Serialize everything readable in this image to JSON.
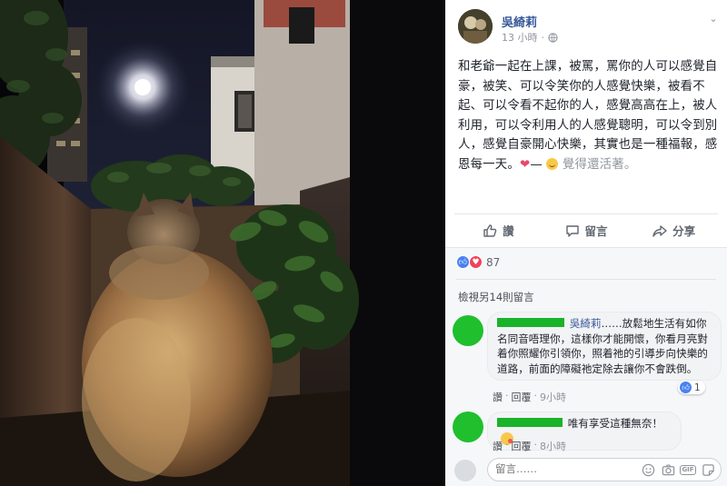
{
  "post": {
    "author": "吳綺莉",
    "time": "13 小時",
    "text_main": "和老爺一起在上課，被罵，罵你的人可以感覺自豪，被笑、可以令笑你的人感覺快樂，被看不起、可以令看不起你的人，感覺高高在上，被人利用，可以令利用人的人感覺聰明，可以令到別人，感覺自豪開心快樂，其實也是一種福報，感恩每一天。",
    "heart": "❤",
    "dash": "—",
    "feeling": "覺得還活著。"
  },
  "actions": {
    "like": "讚",
    "comment": "留言",
    "share": "分享"
  },
  "reactions": {
    "count": "87"
  },
  "comments_header": {
    "view_more": "檢視另14則留言"
  },
  "comments": [
    {
      "mention": "吳綺莉",
      "text": "……放鬆地生活有如你名同音唔理你，這樣你才能開懷，你看月亮對着你照耀你引領你，照着祂的引導步向快樂的道路，前面的障礙祂定除去讓你不會跌倒。",
      "like_label": "讚",
      "reply_label": "回覆",
      "sep": "·",
      "time": "9小時",
      "like_count": "1"
    },
    {
      "text": "唯有享受這種無奈！",
      "like_label": "讚",
      "reply_label": "回覆",
      "sep": "·",
      "time": "8小時"
    }
  ],
  "write_comment": {
    "placeholder": "留言……"
  },
  "icons": {
    "like": "thumbs-up-icon",
    "comment": "speech-bubble-icon",
    "share": "share-arrow-icon",
    "privacy": "globe-icon",
    "emoji": "smiley-icon",
    "camera": "camera-icon",
    "gif": "gif-icon",
    "sticker": "sticker-icon"
  },
  "colors": {
    "link": "#365899",
    "redacted": "#19b32a",
    "like_blue": "#4a82f0",
    "love_red": "#f0435e"
  }
}
